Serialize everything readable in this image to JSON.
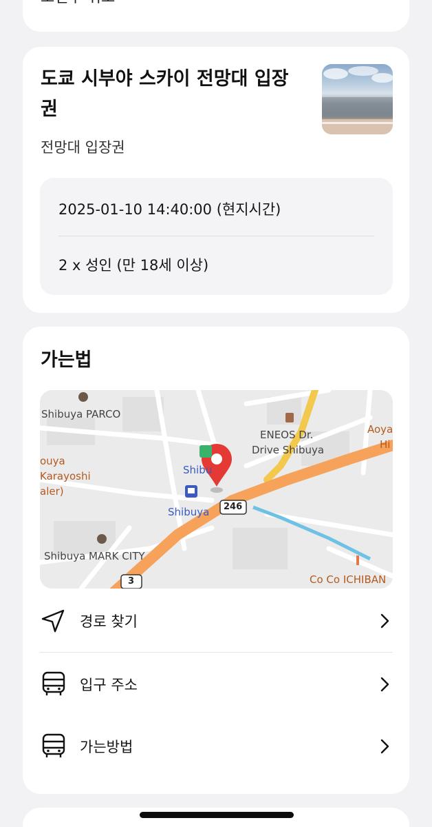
{
  "top_card": {
    "cut_text": "도면주 위도"
  },
  "ticket": {
    "title": "도쿄 시부야 스카이 전망대 입장권",
    "subtitle": "전망대 입장권",
    "datetime": "2025-01-10 14:40:00 (현지시간)",
    "quantity": "2 x 성인 (만 18세 이상)"
  },
  "directions": {
    "title": "가는법",
    "map_labels": {
      "parco": "Shibuya PARCO",
      "eneos_1": "ENEOS Dr.",
      "eneos_2": "Drive Shibuya",
      "aoya": "Aoya",
      "hi": "Hi",
      "karayoshi_1": "ouya",
      "karayoshi_2": "Karayoshi",
      "karayoshi_3": "aler)",
      "shibu_top": "Shibu",
      "shibuya_station": "Shibuya",
      "route_246": "246",
      "mark_city": "Shibuya MARK CITY",
      "route_3": "3",
      "cocoichi": "Co Co ICHIBAN"
    },
    "menu": [
      {
        "label": "경로 찾기",
        "icon": "navigation-arrow-icon"
      },
      {
        "label": "입구 주소",
        "icon": "bus-icon"
      },
      {
        "label": "가는방법",
        "icon": "bus-icon"
      }
    ]
  },
  "colors": {
    "background": "#f2f2f4",
    "card": "#ffffff",
    "info_box": "#f4f4f6",
    "road_major": "#f6a25a",
    "road_yellow": "#f2c94c",
    "pin": "#e53935",
    "rail_blue": "#6ec1e4",
    "station_blue": "#3b5bbf"
  }
}
